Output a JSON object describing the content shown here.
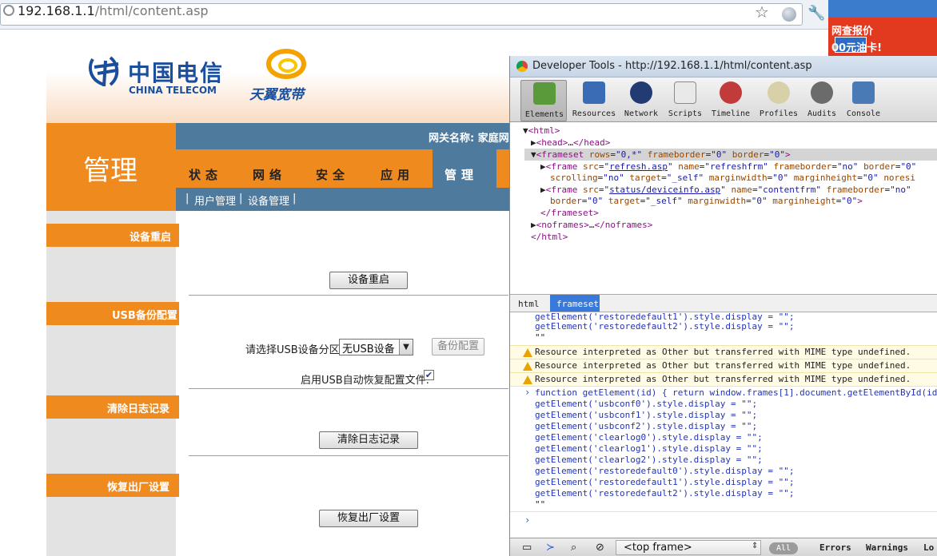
{
  "browser": {
    "url_host": "192.168.1.1",
    "url_path": "/html/content.asp",
    "star_icon": "star-icon",
    "wrench_icon": "wrench-icon"
  },
  "ad": {
    "line1": "网查报价",
    "line2_badge": "00元",
    "line2_text": "油卡!"
  },
  "header": {
    "brand_cn": "中国电信",
    "brand_en": "CHINA TELECOM",
    "brand2": "天翼宽带",
    "gateway_label": "网关名称: 家庭网",
    "left_title": "管理"
  },
  "nav": {
    "tabs": [
      "状态",
      "网络",
      "安全",
      "应用",
      "管理"
    ],
    "active": "管理",
    "sub": [
      "用户管理",
      "设备管理"
    ]
  },
  "sections": [
    {
      "label": "设备重启",
      "button": "设备重启"
    },
    {
      "label": "USB备份配置",
      "select_label": "请选择USB设备分区:",
      "select_value": "无USB设备",
      "button": "备份配置",
      "auto_label": "启用USB自动恢复配置文件:",
      "auto_checked": true
    },
    {
      "label": "清除日志记录",
      "button": "清除日志记录"
    },
    {
      "label": "恢复出厂设置",
      "button": "恢复出厂设置"
    }
  ],
  "devtools": {
    "title": "Developer Tools - http://192.168.1.1/html/content.asp",
    "tools": [
      "Elements",
      "Resources",
      "Network",
      "Scripts",
      "Timeline",
      "Profiles",
      "Audits",
      "Console"
    ],
    "active_tool": "Elements",
    "tool_colors": {
      "Elements": "#5a9a3a",
      "Resources": "#3a6bb5",
      "Network": "#223c73",
      "Scripts": "#8a8a8a",
      "Timeline": "#c23b3b",
      "Profiles": "#b8a14a",
      "Audits": "#6b6b6b",
      "Console": "#4a7ab5"
    },
    "crumbs": [
      "html",
      "frameset"
    ],
    "frame_select": "<top frame>",
    "filters": [
      "All",
      "Errors",
      "Warnings",
      "Lo"
    ],
    "warning": "Resource interpreted as Other but transferred with MIME type undefined."
  }
}
